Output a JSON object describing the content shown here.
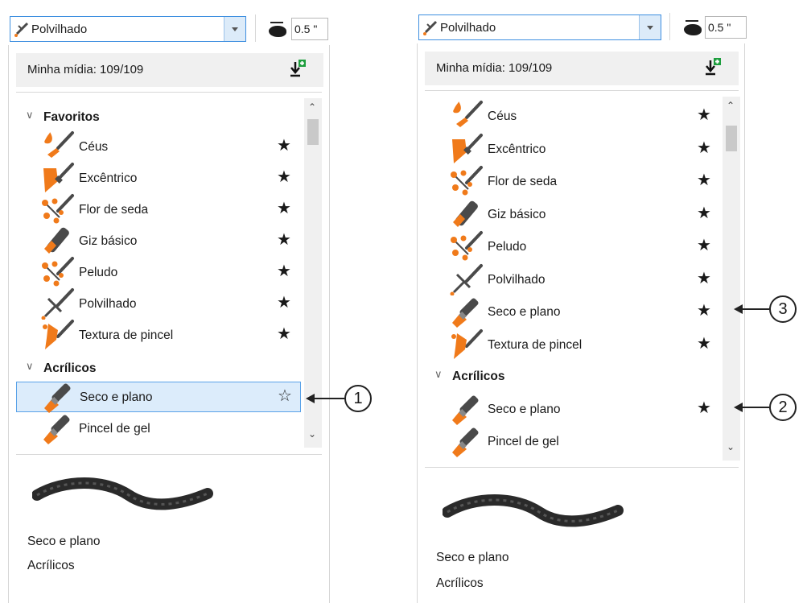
{
  "left": {
    "dropdown_label": "Polvilhado",
    "nib_size": "0.5 \"",
    "media_text": "Minha mídia: 109/109",
    "favorites_label": "Favoritos",
    "favorites": [
      {
        "label": "Céus",
        "icon": "droplet-brush-icon"
      },
      {
        "label": "Excêntrico",
        "icon": "wedge-brush-icon"
      },
      {
        "label": "Flor de seda",
        "icon": "splatter-brush-icon"
      },
      {
        "label": "Giz básico",
        "icon": "chalk-brush-icon"
      },
      {
        "label": "Peludo",
        "icon": "splatter-brush-icon"
      },
      {
        "label": "Polvilhado",
        "icon": "dust-brush-icon"
      },
      {
        "label": "Textura de pincel",
        "icon": "texture-brush-icon"
      }
    ],
    "acrylics_label": "Acrílicos",
    "acrylics": [
      {
        "label": "Seco e plano",
        "icon": "flat-brush-icon",
        "selected": true,
        "star": "☆"
      },
      {
        "label": "Pincel de gel",
        "icon": "flat-brush-icon"
      }
    ],
    "preview_name": "Seco e plano",
    "preview_category": "Acrílicos",
    "callout": "1"
  },
  "right": {
    "dropdown_label": "Polvilhado",
    "nib_size": "0.5 \"",
    "media_text": "Minha mídia: 109/109",
    "favorites": [
      {
        "label": "Céus",
        "icon": "droplet-brush-icon"
      },
      {
        "label": "Excêntrico",
        "icon": "wedge-brush-icon"
      },
      {
        "label": "Flor de seda",
        "icon": "splatter-brush-icon"
      },
      {
        "label": "Giz básico",
        "icon": "chalk-brush-icon"
      },
      {
        "label": "Peludo",
        "icon": "splatter-brush-icon"
      },
      {
        "label": "Polvilhado",
        "icon": "dust-brush-icon"
      },
      {
        "label": "Seco e plano",
        "icon": "flat-brush-icon"
      },
      {
        "label": "Textura de pincel",
        "icon": "texture-brush-icon"
      }
    ],
    "acrylics_label": "Acrílicos",
    "acrylics": [
      {
        "label": "Seco e plano",
        "icon": "flat-brush-icon",
        "star": "★"
      },
      {
        "label": "Pincel de gel",
        "icon": "flat-brush-icon"
      }
    ],
    "preview_name": "Seco e plano",
    "preview_category": "Acrílicos",
    "callout_fav": "3",
    "callout_acr": "2"
  },
  "star_filled": "★",
  "colors": {
    "brush_orange": "#f07a1a",
    "brush_dark": "#4a4a4a",
    "accent_blue": "#3e8fe0"
  }
}
